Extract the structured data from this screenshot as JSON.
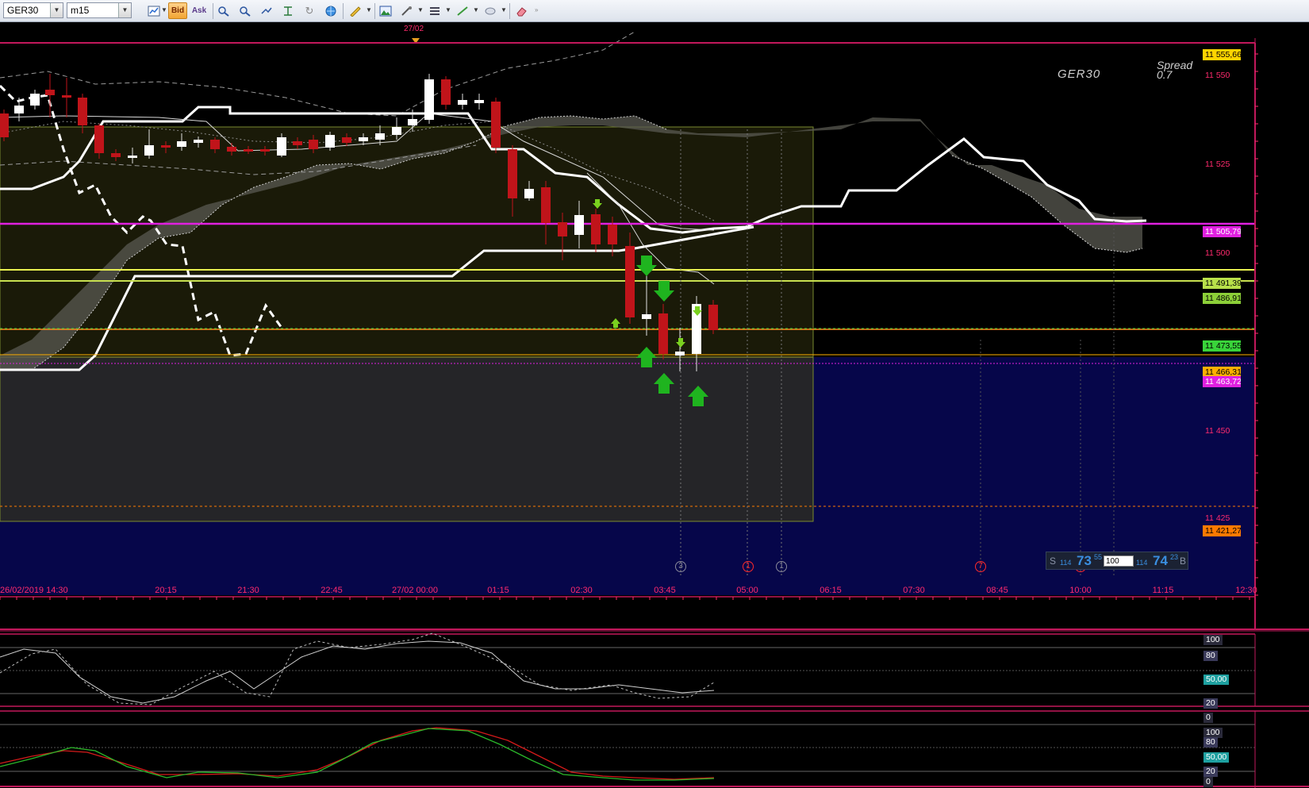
{
  "toolbar": {
    "symbol": "GER30",
    "timeframe": "m15",
    "bid_label": "Bid",
    "ask_label": "Ask"
  },
  "chart": {
    "date_marker": "27/02",
    "symbol_watermark": "GER30",
    "spread_label": "Spread",
    "spread_value": "0.7",
    "price_ticks": [
      "11 550",
      "11 525",
      "11 500",
      "11 450",
      "11 425"
    ],
    "time_ticks": [
      "26/02/2019 14:30",
      "20:15",
      "21:30",
      "22:45",
      "27/02 00:00",
      "01:15",
      "02:30",
      "03:45",
      "05:00",
      "06:15",
      "07:30",
      "08:45",
      "10:00",
      "11:15",
      "12:30"
    ],
    "price_tags": [
      {
        "text": "11 555,66",
        "bg": "#ffd400",
        "fg": "#000000"
      },
      {
        "text": "11 505,79",
        "bg": "#e020e0",
        "fg": "#ffffff"
      },
      {
        "text": "11 491,39",
        "bg": "#b8e04a",
        "fg": "#000000"
      },
      {
        "text": "11 486,91",
        "bg": "#8ccf38",
        "fg": "#000000"
      },
      {
        "text": "11 473,55",
        "bg": "#39d43a",
        "fg": "#000000"
      },
      {
        "text": "11 466,31",
        "bg": "#ffb000",
        "fg": "#000000"
      },
      {
        "text": "11 463,72",
        "bg": "#e020e0",
        "fg": "#ffffff"
      },
      {
        "text": "11 421,27",
        "bg": "#ff7a00",
        "fg": "#000000"
      }
    ],
    "event_markers": [
      {
        "label": "3",
        "color": "#8a8a9a"
      },
      {
        "label": "1",
        "color": "#ff2a2a"
      },
      {
        "label": "1",
        "color": "#8a8a9a"
      },
      {
        "label": "7",
        "color": "#ff2a2a"
      },
      {
        "label": "3",
        "color": "#ff2a2a"
      }
    ]
  },
  "trade_box": {
    "sell_label": "S",
    "sell_small": "114",
    "sell_big": "73",
    "sell_sup": "55",
    "volume": "100",
    "buy_small": "114",
    "buy_big": "74",
    "buy_sup": "23",
    "buy_label": "B"
  },
  "oscillator1": {
    "levels": [
      "100",
      "80",
      "50,00",
      "20",
      "0"
    ]
  },
  "oscillator2": {
    "levels": [
      "100",
      "80",
      "50,00",
      "20",
      "0"
    ]
  },
  "colors": {
    "bear_candle": "#c0141a",
    "bull_candle": "#ffffff",
    "axis": "#ff2a6d",
    "magenta_line": "#e020e0",
    "blue_zone": "#06064a"
  }
}
